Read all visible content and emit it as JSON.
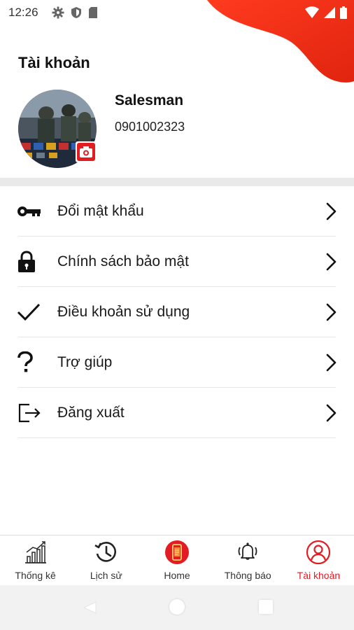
{
  "status_bar": {
    "time": "12:26"
  },
  "header": {
    "title": "Tài khoản",
    "accent_color": "#e31b23"
  },
  "profile": {
    "name": "Salesman",
    "phone": "0901002323"
  },
  "menu": {
    "items": [
      {
        "label": "Đổi mật khẩu",
        "icon": "key-icon"
      },
      {
        "label": "Chính sách bảo mật",
        "icon": "lock-icon"
      },
      {
        "label": "Điều khoản sử dụng",
        "icon": "check-icon"
      },
      {
        "label": "Trợ giúp",
        "icon": "question-icon"
      },
      {
        "label": "Đăng xuất",
        "icon": "logout-icon"
      }
    ]
  },
  "bottom_nav": {
    "tabs": [
      {
        "label": "Thống kê",
        "icon": "chart-icon",
        "active": false
      },
      {
        "label": "Lịch sử",
        "icon": "history-icon",
        "active": false
      },
      {
        "label": "Home",
        "icon": "home-phone-icon",
        "active": false
      },
      {
        "label": "Thông báo",
        "icon": "bell-icon",
        "active": false
      },
      {
        "label": "Tài khoản",
        "icon": "account-icon",
        "active": true
      }
    ]
  }
}
